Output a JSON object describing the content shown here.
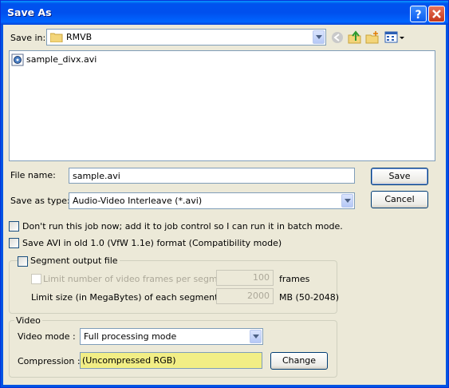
{
  "window": {
    "title": "Save As"
  },
  "save_in": {
    "label": "Save in:",
    "value": "RMVB"
  },
  "files": [
    {
      "name": "sample_divx.avi"
    }
  ],
  "file_name": {
    "label": "File name:",
    "value": "sample.avi"
  },
  "save_as_type": {
    "label": "Save as type:",
    "value": "Audio-Video Interleave (*.avi)"
  },
  "buttons": {
    "save": "Save",
    "cancel": "Cancel",
    "change": "Change"
  },
  "options": {
    "batch": "Don't run this job now; add it to job control so I can run it in batch mode.",
    "old_avi": "Save AVI in old 1.0 (VfW 1.1e) format (Compatibility mode)"
  },
  "segment": {
    "title": "Segment output file",
    "limit_frames_label": "Limit number of video frames per segment to",
    "frames_value": "100",
    "frames_unit": "frames",
    "limit_size_label": "Limit size (in MegaBytes) of each segment to :",
    "size_value": "2000",
    "size_unit": "MB (50-2048)"
  },
  "video": {
    "title": "Video",
    "mode_label": "Video mode :",
    "mode_value": "Full processing mode",
    "compression_label": "Compression :",
    "compression_value": "(Uncompressed RGB)"
  },
  "colors": {
    "titlebar": "#0054e3",
    "face": "#ece9d8",
    "compression_bg": "#f2ee85"
  }
}
